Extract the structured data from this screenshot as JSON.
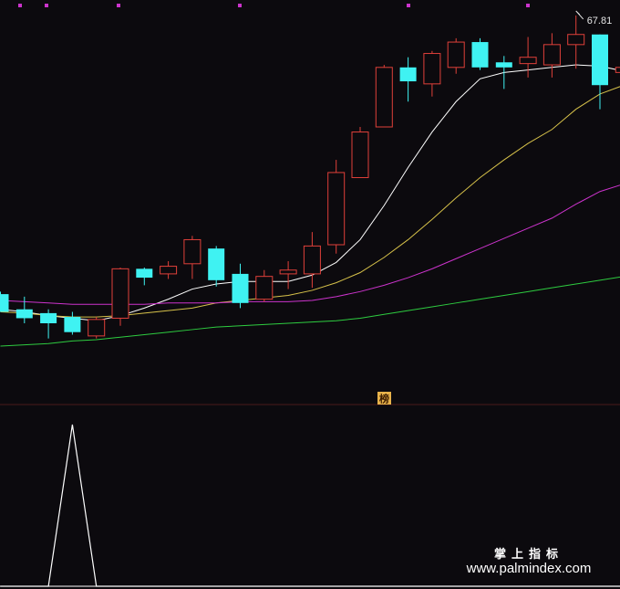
{
  "chart_data": [
    {
      "type": "candlestick",
      "title": "",
      "price_label": "67.81",
      "up_color": "#e0403a",
      "down_color": "#3ff2f2",
      "background": "#0c0a0e",
      "ylim": [
        38.5,
        69.5
      ],
      "candles": [
        {
          "o": 47.0,
          "h": 47.2,
          "l": 45.6,
          "c": 45.6
        },
        {
          "o": 45.8,
          "h": 46.8,
          "l": 44.7,
          "c": 45.1
        },
        {
          "o": 45.5,
          "h": 45.8,
          "l": 43.5,
          "c": 44.7
        },
        {
          "o": 45.2,
          "h": 45.6,
          "l": 43.8,
          "c": 44.0
        },
        {
          "o": 43.7,
          "h": 45.2,
          "l": 43.5,
          "c": 45.0
        },
        {
          "o": 45.1,
          "h": 49.1,
          "l": 44.5,
          "c": 49.0
        },
        {
          "o": 49.0,
          "h": 49.1,
          "l": 47.7,
          "c": 48.3
        },
        {
          "o": 48.6,
          "h": 49.6,
          "l": 48.2,
          "c": 49.2
        },
        {
          "o": 49.4,
          "h": 51.6,
          "l": 48.2,
          "c": 51.3
        },
        {
          "o": 50.6,
          "h": 50.8,
          "l": 47.6,
          "c": 48.1
        },
        {
          "o": 48.6,
          "h": 49.4,
          "l": 45.9,
          "c": 46.3
        },
        {
          "o": 46.6,
          "h": 48.9,
          "l": 46.4,
          "c": 48.4
        },
        {
          "o": 48.6,
          "h": 49.6,
          "l": 47.4,
          "c": 48.9
        },
        {
          "o": 48.6,
          "h": 51.9,
          "l": 47.5,
          "c": 50.8
        },
        {
          "o": 50.9,
          "h": 57.6,
          "l": 50.2,
          "c": 56.6
        },
        {
          "o": 56.2,
          "h": 60.2,
          "l": 56.2,
          "c": 59.8
        },
        {
          "o": 60.2,
          "h": 65.1,
          "l": 60.2,
          "c": 64.9
        },
        {
          "o": 64.9,
          "h": 65.7,
          "l": 62.2,
          "c": 63.8
        },
        {
          "o": 63.6,
          "h": 66.2,
          "l": 62.6,
          "c": 66.0
        },
        {
          "o": 64.9,
          "h": 67.2,
          "l": 64.4,
          "c": 66.9
        },
        {
          "o": 66.9,
          "h": 67.2,
          "l": 64.7,
          "c": 64.9
        },
        {
          "o": 65.3,
          "h": 65.8,
          "l": 63.2,
          "c": 64.9
        },
        {
          "o": 65.2,
          "h": 67.3,
          "l": 64.1,
          "c": 65.7
        },
        {
          "o": 65.1,
          "h": 67.6,
          "l": 64.1,
          "c": 66.7
        },
        {
          "o": 66.7,
          "h": 69.0,
          "l": 64.8,
          "c": 67.5
        },
        {
          "o": 67.5,
          "h": 67.5,
          "l": 61.6,
          "c": 63.5
        },
        {
          "o": 64.5,
          "h": 65.9,
          "l": 63.6,
          "c": 64.9
        }
      ],
      "moving_averages": [
        {
          "color": "#ffffff",
          "values": [
            45.8,
            45.6,
            45.3,
            45.1,
            44.9,
            45.3,
            45.9,
            46.6,
            47.4,
            47.8,
            48.0,
            48.0,
            48.0,
            48.5,
            49.5,
            51.3,
            54.0,
            57.0,
            59.8,
            62.2,
            64.0,
            64.5,
            64.7,
            64.9,
            65.1,
            65.0,
            64.6
          ]
        },
        {
          "color": "#d7c24a",
          "values": [
            45.6,
            45.5,
            45.3,
            45.2,
            45.2,
            45.3,
            45.5,
            45.7,
            45.9,
            46.3,
            46.5,
            46.7,
            46.9,
            47.3,
            47.9,
            48.7,
            49.9,
            51.3,
            52.9,
            54.6,
            56.2,
            57.6,
            58.9,
            60.0,
            61.6,
            62.8,
            63.5
          ]
        },
        {
          "color": "#cc33cc",
          "values": [
            46.5,
            46.4,
            46.3,
            46.2,
            46.2,
            46.2,
            46.2,
            46.3,
            46.3,
            46.3,
            46.4,
            46.4,
            46.4,
            46.5,
            46.8,
            47.2,
            47.7,
            48.3,
            49.0,
            49.8,
            50.6,
            51.4,
            52.2,
            53.0,
            54.1,
            55.1,
            55.7
          ]
        },
        {
          "color": "#2ecc40",
          "values": [
            42.9,
            43.0,
            43.1,
            43.3,
            43.4,
            43.6,
            43.8,
            44.0,
            44.2,
            44.4,
            44.5,
            44.6,
            44.7,
            44.8,
            44.9,
            45.1,
            45.4,
            45.7,
            46.0,
            46.3,
            46.6,
            46.9,
            47.2,
            47.5,
            47.8,
            48.1,
            48.4
          ]
        }
      ],
      "annotation": "榜"
    },
    {
      "type": "line",
      "title": "",
      "color": "#ffffff",
      "ylim": [
        0,
        1
      ],
      "values": [
        0,
        0,
        0,
        1,
        0,
        0,
        0,
        0,
        0,
        0,
        0,
        0,
        0,
        0,
        0,
        0,
        0,
        0,
        0,
        0,
        0,
        0,
        0,
        0,
        0,
        0,
        0
      ]
    }
  ],
  "watermark": {
    "cn": "掌上指标",
    "url": "www.palmindex.com"
  }
}
